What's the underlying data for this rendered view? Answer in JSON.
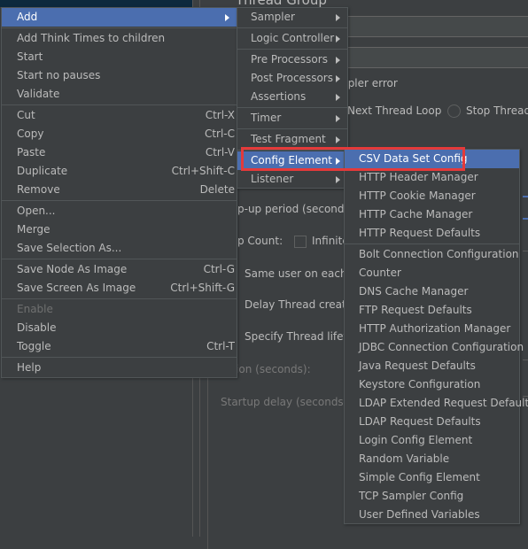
{
  "editor": {
    "title": "Thread Group",
    "sampler_error_label": "mpler error",
    "radio_next_loop": "Next Thread Loop",
    "radio_stop_thread": "Stop Thread",
    "rampup_label": "p-up period (seconds):",
    "loop_count_label": "p Count:",
    "infinite_label": "Infinite",
    "same_user_label": "Same user on each ite",
    "delay_thread_label": "Delay Thread creation",
    "specify_lifetime_label": "Specify Thread lifetim",
    "duration_label": "ation (seconds):",
    "startup_delay_label": "Startup delay (seconds):"
  },
  "context_menu": {
    "groups": [
      [
        {
          "label": "Add",
          "submenu": true,
          "active": true
        }
      ],
      [
        {
          "label": "Add Think Times to children"
        },
        {
          "label": "Start"
        },
        {
          "label": "Start no pauses"
        },
        {
          "label": "Validate"
        }
      ],
      [
        {
          "label": "Cut",
          "shortcut": "Ctrl-X"
        },
        {
          "label": "Copy",
          "shortcut": "Ctrl-C"
        },
        {
          "label": "Paste",
          "shortcut": "Ctrl-V"
        },
        {
          "label": "Duplicate",
          "shortcut": "Ctrl+Shift-C"
        },
        {
          "label": "Remove",
          "shortcut": "Delete"
        }
      ],
      [
        {
          "label": "Open..."
        },
        {
          "label": "Merge"
        },
        {
          "label": "Save Selection As..."
        }
      ],
      [
        {
          "label": "Save Node As Image",
          "shortcut": "Ctrl-G"
        },
        {
          "label": "Save Screen As Image",
          "shortcut": "Ctrl+Shift-G"
        }
      ],
      [
        {
          "label": "Enable",
          "disabled": true
        },
        {
          "label": "Disable"
        },
        {
          "label": "Toggle",
          "shortcut": "Ctrl-T"
        }
      ],
      [
        {
          "label": "Help"
        }
      ]
    ]
  },
  "add_submenu": {
    "groups": [
      [
        {
          "label": "Sampler",
          "submenu": true
        }
      ],
      [
        {
          "label": "Logic Controller",
          "submenu": true
        }
      ],
      [
        {
          "label": "Pre Processors",
          "submenu": true
        },
        {
          "label": "Post Processors",
          "submenu": true
        },
        {
          "label": "Assertions",
          "submenu": true
        }
      ],
      [
        {
          "label": "Timer",
          "submenu": true
        }
      ],
      [
        {
          "label": "Test Fragment",
          "submenu": true
        }
      ],
      [
        {
          "label": "Config Element",
          "submenu": true,
          "active": true
        },
        {
          "label": "Listener",
          "submenu": true
        }
      ]
    ]
  },
  "config_submenu": {
    "groups": [
      [
        {
          "label": "CSV Data Set Config",
          "active": true
        },
        {
          "label": "HTTP Header Manager"
        },
        {
          "label": "HTTP Cookie Manager"
        },
        {
          "label": "HTTP Cache Manager"
        },
        {
          "label": "HTTP Request Defaults"
        }
      ],
      [
        {
          "label": "Bolt Connection Configuration"
        },
        {
          "label": "Counter"
        },
        {
          "label": "DNS Cache Manager"
        },
        {
          "label": "FTP Request Defaults"
        },
        {
          "label": "HTTP Authorization Manager"
        },
        {
          "label": "JDBC Connection Configuration"
        },
        {
          "label": "Java Request Defaults"
        },
        {
          "label": "Keystore Configuration"
        },
        {
          "label": "LDAP Extended Request Defaults"
        },
        {
          "label": "LDAP Request Defaults"
        },
        {
          "label": "Login Config Element"
        },
        {
          "label": "Random Variable"
        },
        {
          "label": "Simple Config Element"
        },
        {
          "label": "TCP Sampler Config"
        },
        {
          "label": "User Defined Variables"
        }
      ]
    ]
  },
  "colors": {
    "highlight": "#4b6eaf",
    "annotation_box": "#e43a3a",
    "menu_bg": "#3c3f41"
  }
}
